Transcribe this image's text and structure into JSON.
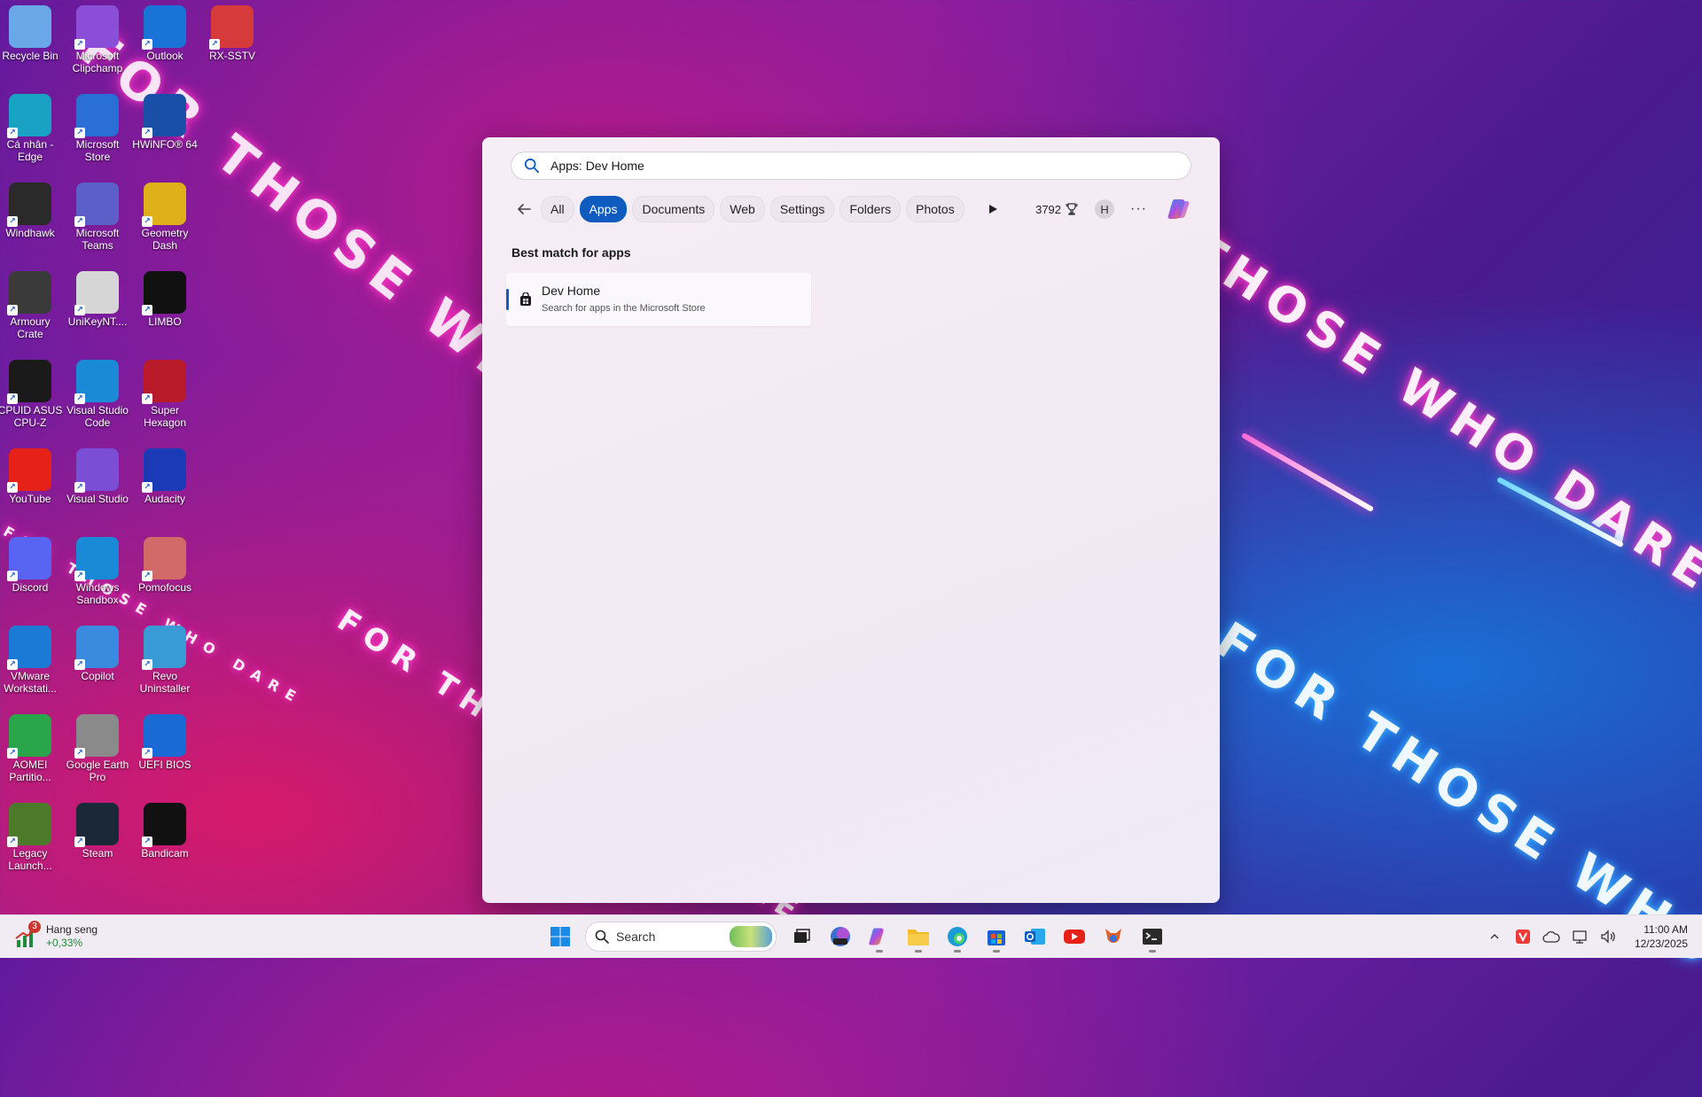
{
  "wallpaper": {
    "slogan": "FOR THOSE WHO DARE"
  },
  "desktop_icons": [
    {
      "label": "Recycle Bin",
      "icon": "recycle-bin-icon",
      "color": "#6aa7e8"
    },
    {
      "label": "Microsoft Clipchamp",
      "icon": "clipchamp-icon",
      "color": "#8a4fd6"
    },
    {
      "label": "Outlook",
      "icon": "outlook-icon",
      "color": "#1a73d6"
    },
    {
      "label": "RX-SSTV",
      "icon": "tv-icon",
      "color": "#d63a3a"
    },
    {
      "label": "Cá nhân - Edge",
      "icon": "edge-icon",
      "color": "#1aa2c4"
    },
    {
      "label": "Microsoft Store",
      "icon": "store-icon",
      "color": "#2a6fd6"
    },
    {
      "label": "HWiNFO® 64",
      "icon": "hwinfo-icon",
      "color": "#1a4fa8"
    },
    {
      "label": "Windhawk",
      "icon": "hawk-icon",
      "color": "#2a2a2a"
    },
    {
      "label": "Microsoft Teams",
      "icon": "teams-icon",
      "color": "#5b5fc7"
    },
    {
      "label": "Geometry Dash",
      "icon": "geometry-dash-icon",
      "color": "#e0b01a"
    },
    {
      "label": "Armoury Crate",
      "icon": "armoury-crate-icon",
      "color": "#3a3a3a"
    },
    {
      "label": "UniKeyNT....",
      "icon": "unikey-icon",
      "color": "#d6d6d6"
    },
    {
      "label": "LIMBO",
      "icon": "limbo-icon",
      "color": "#111111"
    },
    {
      "label": "CPUID ASUS CPU-Z",
      "icon": "cpuz-icon",
      "color": "#1a1a1a"
    },
    {
      "label": "Visual Studio Code",
      "icon": "vscode-icon",
      "color": "#1a8ad6"
    },
    {
      "label": "Super Hexagon",
      "icon": "hexagon-icon",
      "color": "#b81a2a"
    },
    {
      "label": "YouTube",
      "icon": "youtube-icon",
      "color": "#e62117"
    },
    {
      "label": "Visual Studio",
      "icon": "visual-studio-icon",
      "color": "#7a4fd6"
    },
    {
      "label": "Audacity",
      "icon": "audacity-icon",
      "color": "#1a3ab8"
    },
    {
      "label": "Discord",
      "icon": "discord-icon",
      "color": "#5865f2"
    },
    {
      "label": "Windows Sandbox",
      "icon": "sandbox-icon",
      "color": "#1a8ad6"
    },
    {
      "label": "Pomofocus",
      "icon": "pomofocus-icon",
      "color": "#d26a6a"
    },
    {
      "label": "VMware Workstati...",
      "icon": "vmware-icon",
      "color": "#1a7ad6"
    },
    {
      "label": "Copilot",
      "icon": "copilot-icon",
      "color": "#3a8ae0"
    },
    {
      "label": "Revo Uninstaller",
      "icon": "revo-icon",
      "color": "#3a9ad6"
    },
    {
      "label": "AOMEI Partitio...",
      "icon": "aomei-icon",
      "color": "#2aa64a"
    },
    {
      "label": "Google Earth Pro",
      "icon": "google-earth-icon",
      "color": "#8a8a8a"
    },
    {
      "label": "UEFI BIOS",
      "icon": "uefi-bios-icon",
      "color": "#1a6ad6"
    },
    {
      "label": "Legacy Launch...",
      "icon": "minecraft-icon",
      "color": "#4a7a2a"
    },
    {
      "label": "Steam",
      "icon": "steam-icon",
      "color": "#1b2838"
    },
    {
      "label": "Bandicam",
      "icon": "bandicam-icon",
      "color": "#111111"
    }
  ],
  "search": {
    "query": "Apps: Dev Home",
    "filters": [
      "All",
      "Apps",
      "Documents",
      "Web",
      "Settings",
      "Folders",
      "Photos"
    ],
    "active_filter": "Apps",
    "points": "3792",
    "avatar_initial": "H",
    "more": "···",
    "section_title": "Best match for apps",
    "result": {
      "title": "Dev Home",
      "subtitle": "Search for apps in the Microsoft Store"
    }
  },
  "taskbar": {
    "widget_title": "Hang seng",
    "widget_value": "+0,33%",
    "widget_badge": "3",
    "search_placeholder": "Search",
    "time": "11:00 AM",
    "date": "12/23/2025"
  }
}
